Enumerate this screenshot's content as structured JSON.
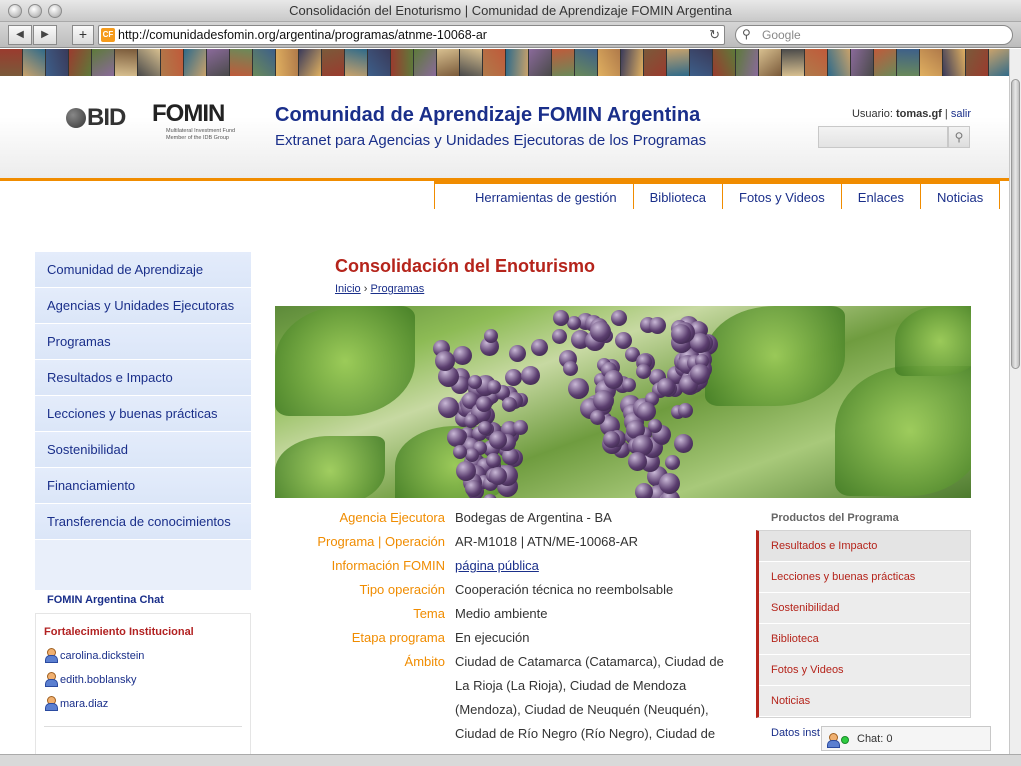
{
  "window": {
    "title": "Consolidación del Enoturismo | Comunidad de Aprendizaje FOMIN Argentina"
  },
  "browser": {
    "url": "http://comunidadesfomin.org/argentina/programas/atnme-10068-ar",
    "favicon_text": "CF",
    "search_placeholder": "Google"
  },
  "header": {
    "logo_bid": "BID",
    "logo_fomin": "FOMIN",
    "logo_fomin_sub": "Multilateral Investment Fund Member of the IDB Group",
    "title": "Comunidad de Aprendizaje FOMIN Argentina",
    "subtitle": "Extranet para Agencias y Unidades Ejecutoras de los Programas",
    "user_label": "Usuario:",
    "user_name": "tomas.gf",
    "separator": "|",
    "logout": "salir"
  },
  "topnav": [
    {
      "label": "Herramientas de gestión"
    },
    {
      "label": "Biblioteca"
    },
    {
      "label": "Fotos y Videos"
    },
    {
      "label": "Enlaces"
    },
    {
      "label": "Noticias"
    }
  ],
  "sidebar": {
    "items": [
      {
        "label": "Comunidad de Aprendizaje"
      },
      {
        "label": "Agencias y Unidades Ejecutoras"
      },
      {
        "label": "Programas"
      },
      {
        "label": "Resultados e Impacto"
      },
      {
        "label": "Lecciones y buenas prácticas"
      },
      {
        "label": "Sostenibilidad"
      },
      {
        "label": "Financiamiento"
      },
      {
        "label": "Transferencia de conocimientos"
      }
    ]
  },
  "chat": {
    "title": "FOMIN Argentina Chat",
    "group": "Fortalecimiento Institucional",
    "users": [
      "carolina.dickstein",
      "edith.boblansky",
      "mara.diaz"
    ],
    "bar_label": "Chat: 0"
  },
  "main": {
    "title": "Consolidación del Enoturismo",
    "breadcrumb": {
      "home": "Inicio",
      "sep": "›",
      "current": "Programas"
    },
    "info": [
      {
        "label": "Agencia Ejecutora",
        "value": "Bodegas de Argentina - BA"
      },
      {
        "label": "Programa | Operación",
        "value": "AR-M1018 | ATN/ME-10068-AR"
      },
      {
        "label": "Información FOMIN",
        "value": "página pública"
      },
      {
        "label": "Tipo operación",
        "value": "Cooperación técnica no reembolsable"
      },
      {
        "label": "Tema",
        "value": "Medio ambiente"
      },
      {
        "label": "Etapa programa",
        "value": "En ejecución"
      },
      {
        "label": "Ámbito",
        "value": "Ciudad de Catamarca (Catamarca), Ciudad de La Rioja (La Rioja), Ciudad de Mendoza (Mendoza), Ciudad de Neuquén (Neuquén), Ciudad de Río Negro (Río Negro), Ciudad de"
      }
    ]
  },
  "products": {
    "title": "Productos del Programa",
    "items": [
      {
        "label": "Resultados e Impacto"
      },
      {
        "label": "Lecciones y buenas prácticas"
      },
      {
        "label": "Sostenibilidad"
      },
      {
        "label": "Biblioteca"
      },
      {
        "label": "Fotos y Videos"
      },
      {
        "label": "Noticias"
      }
    ],
    "extra": "Datos inst"
  },
  "colors": {
    "accent": "#f08c00",
    "brand": "#1a2f8a",
    "title_red": "#b5241b"
  }
}
